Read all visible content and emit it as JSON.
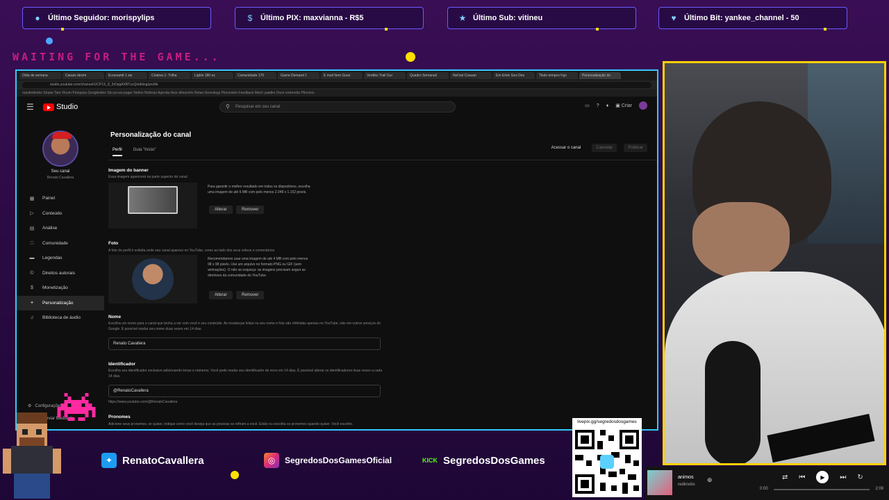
{
  "overlay": {
    "stats": [
      {
        "icon": "user-icon",
        "text": "Último Seguidor: morispylips"
      },
      {
        "icon": "dollar-icon",
        "text": "Último PIX: maxvianna - R$5"
      },
      {
        "icon": "star-icon",
        "text": "Último Sub: vitineu"
      },
      {
        "icon": "heart-gem-icon",
        "text": "Último Bit: yankee_channel - 50"
      }
    ],
    "waiting": "WAITING FOR THE GAME..."
  },
  "browser": {
    "tabs": [
      "Odia de semana",
      "Canais decim",
      "Ecrunamit 1 sw",
      "Criativa 1- Trilha",
      "Lights 180 ez",
      "Comunidade 170",
      "Game Demand 1",
      "E mail Item Gues",
      "Verdiko Trail Gui",
      "Quadro Semanali",
      "Net'sal Cosuan",
      "Em Erbic Ges Des",
      "Titulo tempos Fgo",
      "Personalização do"
    ],
    "url": "studio.youtube.com/channel/UCP1S_8_3rDpgAXBTuvQ/editing/profile",
    "bookmarks": "outubirdesbo  Strpas  Tam Vinum  Pesquisa  Googlesiten  Sto pa wa pager  Notion  Noticias  Agenda  lince dimanchv  Notas  Grenvlegs  Plocontelo  Feedback  Mech yaadim  Doce entrendar  Plinchos"
  },
  "yt": {
    "logo_text": "Studio",
    "search_placeholder": "Pesquisar em seu canal",
    "create_label": "Criar",
    "channel_name": "Seu canal",
    "channel_sub": "Renato Cavallera",
    "nav": [
      {
        "icon": "dashboard-icon",
        "label": "Painel"
      },
      {
        "icon": "content-icon",
        "label": "Conteúdo"
      },
      {
        "icon": "analytics-icon",
        "label": "Análise"
      },
      {
        "icon": "community-icon",
        "label": "Comunidade"
      },
      {
        "icon": "subtitles-icon",
        "label": "Legendas"
      },
      {
        "icon": "copyright-icon",
        "label": "Direitos autorais"
      },
      {
        "icon": "monetization-icon",
        "label": "Monetização"
      },
      {
        "icon": "customization-icon",
        "label": "Personalização"
      },
      {
        "icon": "audio-library-icon",
        "label": "Biblioteca de áudio"
      }
    ],
    "settings_label": "Configurações",
    "feedback_label": "Enviar feedback",
    "page_title": "Personalização do canal",
    "subtabs": [
      "Perfil",
      "Guia \"Início\""
    ],
    "btn_view": "Acessar o canal",
    "btn_cancel": "Cancelar",
    "btn_publish": "Publicar",
    "banner": {
      "title": "Imagem do banner",
      "desc": "Essa imagem aparecerá na parte superior do canal",
      "info": "Para garantir o melhor resultado em todos os dispositivos, escolha uma imagem de até 6 MB com pelo menos 2.048 x 1.152 pixels.",
      "change": "Alterar",
      "remove": "Remover"
    },
    "photo": {
      "title": "Foto",
      "desc": "A foto do perfil é exibida onde seu canal aparece no YouTube, como ao lado dos seus vídeos e comentários",
      "info": "Recomendamos usar uma imagem de até 4 MB com pelo menos 98 x 98 pixels. Use um arquivo no formato PNG ou GIF (sem animações). O não se esqueça: as imagens precisam seguir as diretrizes da comunidade do YouTube.",
      "change": "Alterar",
      "remove": "Remover"
    },
    "name": {
      "title": "Nome",
      "desc": "Escolha um nome para o canal que tenha a ver com você e seu conteúdo. As mudanças feitas no seu nome e foto são refletidas apenas no YouTube, não em outros serviços do Google. É possível mudar seu nome duas vezes em 14 dias.",
      "value": "Renato Cavallera"
    },
    "handle": {
      "title": "Identificador",
      "desc": "Escolha seu identificador exclusivo adicionando letras e números. Você pode mudar seu identificador de novo em 14 dias. É possível alterar os identificadores duas vezes a cada 14 dias.",
      "value": "@RenatoCavallera",
      "link": "https://www.youtube.com/@RenatoCavallera"
    },
    "pronouns": {
      "title": "Pronomes",
      "desc": "Adicione seus pronomes, se quiser, indique como você deseja que as pessoas se refiram a você. Estão ou escolha os pronomes quando quiser. Você escolhe."
    }
  },
  "social": {
    "twitter": "RenatoCavallera",
    "instagram": "SegredosDosGamesOficial",
    "kick_logo": "KICK",
    "kick": "SegredosDosGames",
    "qr_label": "livepix.gg/segredosdosgames"
  },
  "player": {
    "song": "animos",
    "artist": "redknobs",
    "time_start": "0:00",
    "time_end": "2:09"
  },
  "colors": {
    "stat_border": "#6a5cff",
    "browser_border": "#35c8ff",
    "cam_border": "#ffd200",
    "waiting": "#e0208a",
    "yt_red": "#ff0000"
  }
}
